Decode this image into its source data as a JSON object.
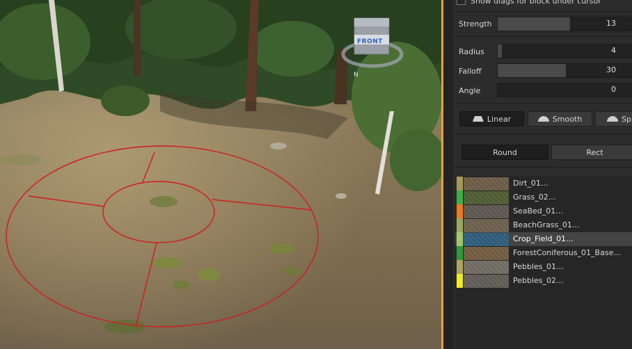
{
  "viewport": {
    "gizmo_face_label": "FRONT",
    "gizmo_axis_label": "N"
  },
  "panel": {
    "diag_checkbox_label": "Show diags for block under cursor",
    "sliders": [
      {
        "label": "Strength",
        "value": "13",
        "fraction": 0.52
      },
      {
        "label": "Radius",
        "value": "4",
        "fraction": 0.03
      },
      {
        "label": "Falloff",
        "value": "30",
        "fraction": 0.49
      },
      {
        "label": "Angle",
        "value": "0",
        "fraction": 0.0
      }
    ],
    "falloff_buttons": [
      {
        "label": "Linear",
        "active": true
      },
      {
        "label": "Smooth",
        "active": false
      },
      {
        "label": "Sp",
        "active": false
      }
    ],
    "shape_buttons": [
      {
        "label": "Round",
        "active": true
      },
      {
        "label": "Rect",
        "active": false
      }
    ],
    "layers": [
      {
        "name": "Dirt_01...",
        "color": "#a89a55",
        "thumb": "#6b5a45",
        "selected": false
      },
      {
        "name": "Grass_02...",
        "color": "#3fae4a",
        "thumb": "#4d5a32",
        "selected": false
      },
      {
        "name": "SeaBed_01...",
        "color": "#f07a16",
        "thumb": "#5c5650",
        "selected": false
      },
      {
        "name": "BeachGrass_01...",
        "color": "#9aa860",
        "thumb": "#6a5e4c",
        "selected": false
      },
      {
        "name": "Crop_Field_01...",
        "color": "#a8c46a",
        "thumb": "#2e5a78",
        "selected": true
      },
      {
        "name": "ForestConiferous_01_Base...",
        "color": "#2e9a3a",
        "thumb": "#6f5a3e",
        "selected": false
      },
      {
        "name": "Pebbles_01...",
        "color": "#b0a560",
        "thumb": "#6e6a62",
        "selected": false
      },
      {
        "name": "Pebbles_02...",
        "color": "#f2ee1a",
        "thumb": "#5e5a55",
        "selected": false
      }
    ]
  }
}
